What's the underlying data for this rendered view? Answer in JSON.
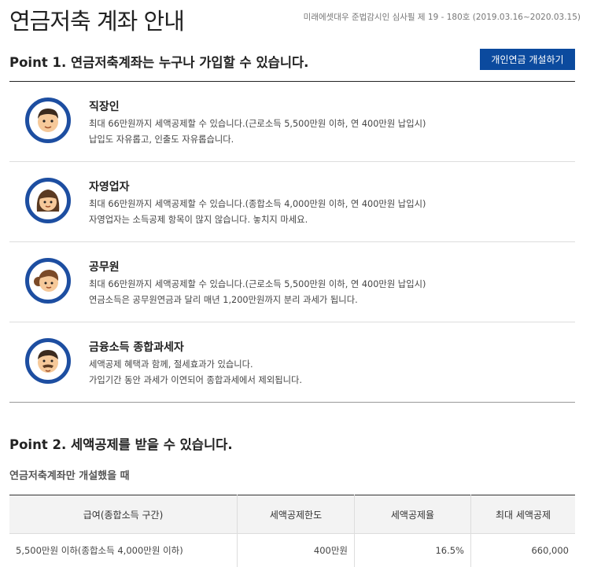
{
  "header": {
    "title": "연금저축 계좌 안내",
    "compliance": "미래에셋대우 준법감시인 심사필 제 19 - 180호 (2019.03.16~2020.03.15)"
  },
  "point1": {
    "title": "Point 1. 연금저축계좌는 누구나 가입할 수 있습니다.",
    "button": "개인연금 개설하기",
    "items": [
      {
        "title": "직장인",
        "line1": "최대 66만원까지 세액공제할 수 있습니다.(근로소득 5,500만원 이하, 연 400만원 납입시)",
        "line2": "납입도 자유롭고, 인출도 자유롭습니다.",
        "icon": "office-worker-icon"
      },
      {
        "title": "자영업자",
        "line1": "최대 66만원까지 세액공제할 수 있습니다.(종합소득 4,000만원 이하, 연 400만원 납입시)",
        "line2": "자영업자는 소득공제 항목이 많지 않습니다. 놓치지 마세요.",
        "icon": "self-employed-icon"
      },
      {
        "title": "공무원",
        "line1": "최대 66만원까지 세액공제할 수 있습니다.(근로소득 5,500만원 이하, 연 400만원 납입시)",
        "line2": "연금소득은 공무원연금과 달리 매년 1,200만원까지 분리 과세가 됩니다.",
        "icon": "civil-servant-icon"
      },
      {
        "title": "금융소득 종합과세자",
        "line1": "세액공제 혜택과 함께, 절세효과가 있습니다.",
        "line2": "가입기간 동안 과세가 이연되어 종합과세에서 제외됩니다.",
        "icon": "financial-income-taxpayer-icon"
      }
    ]
  },
  "point2": {
    "title": "Point 2. 세액공제를 받을 수 있습니다.",
    "subtitle": "연금저축계좌만 개설했을 때",
    "table": {
      "headers": [
        "급여(종합소득 구간)",
        "세액공제한도",
        "세액공제율",
        "최대 세액공제"
      ],
      "rows": [
        [
          "5,500만원 이하(종합소득 4,000만원 이하)",
          "400만원",
          "16.5%",
          "660,000"
        ]
      ]
    }
  },
  "colors": {
    "accent": "#0b4a9e",
    "ring": "#1d4ea1",
    "skin": "#f6c99a",
    "hair": "#3b2a1e"
  }
}
